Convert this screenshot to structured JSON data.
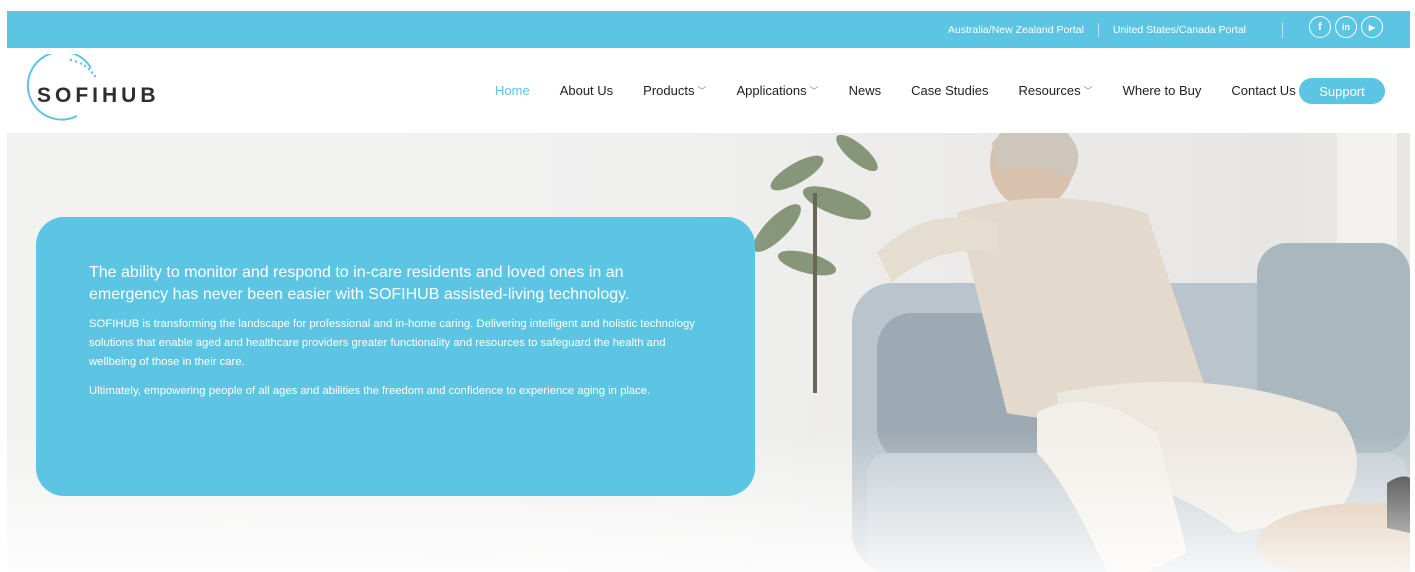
{
  "topbar": {
    "portal_anz": "Australia/New Zealand Portal",
    "portal_us": "United States/Canada Portal",
    "social": [
      {
        "icon": "facebook-icon",
        "glyph": "f"
      },
      {
        "icon": "linkedin-icon",
        "glyph": "in"
      },
      {
        "icon": "youtube-icon",
        "glyph": "▶"
      }
    ]
  },
  "brand": {
    "name": "SOFIHUB"
  },
  "nav": {
    "items": [
      {
        "label": "Home",
        "active": true
      },
      {
        "label": "About Us"
      },
      {
        "label": "Products",
        "dropdown": true
      },
      {
        "label": "Applications",
        "dropdown": true
      },
      {
        "label": "News"
      },
      {
        "label": "Case Studies"
      },
      {
        "label": "Resources",
        "dropdown": true
      },
      {
        "label": "Where to Buy"
      },
      {
        "label": "Contact Us"
      }
    ],
    "support_label": "Support"
  },
  "hero": {
    "lead": "The ability to monitor and respond to in-care residents and loved ones in an emergency has never been easier with SOFIHUB assisted-living technology.",
    "body1": "SOFIHUB is transforming the landscape for professional and in-home caring. Delivering intelligent and holistic technology solutions that enable aged and healthcare providers greater functionality and resources to safeguard the health and wellbeing of those in their care.",
    "body2": "Ultimately, empowering people of all ages and abilities the freedom and confidence to experience aging in place."
  },
  "colors": {
    "accent": "#5bc5e3",
    "text": "#1e1e1e",
    "white": "#ffffff"
  }
}
